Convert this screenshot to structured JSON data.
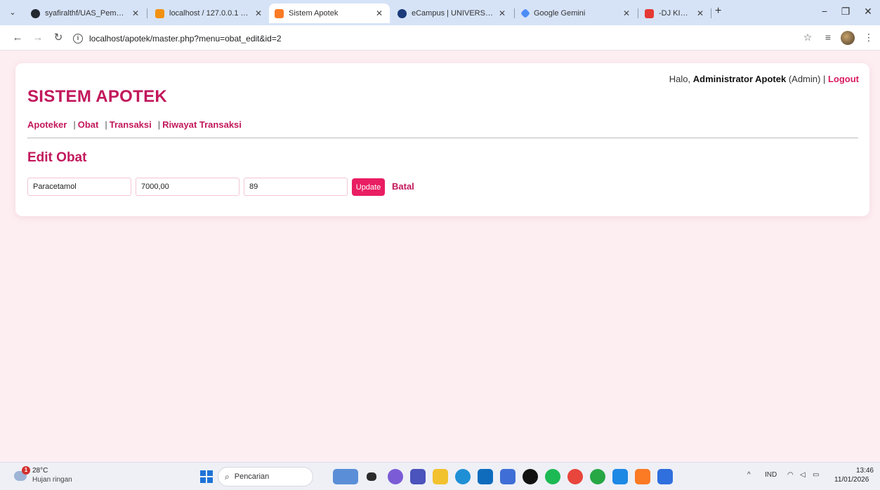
{
  "browser": {
    "tabs": [
      {
        "title": "syafiralthf/UAS_Pemrogram",
        "favicon_color": "#24292f"
      },
      {
        "title": "localhost / 127.0.0.1 / apo",
        "favicon_color": "#f29111"
      },
      {
        "title": "Sistem Apotek",
        "favicon_color": "#fb7a24"
      },
      {
        "title": "eCampus | UNIVERSITAS P",
        "favicon_color": "#1a3a7a"
      },
      {
        "title": "Google Gemini",
        "favicon_color": "#4c8df6"
      },
      {
        "title": "-DJ KISAH TANPA DIRI",
        "favicon_color": "#e53935"
      }
    ],
    "url": "localhost/apotek/master.php?menu=obat_edit&id=2"
  },
  "page": {
    "app_title": "SISTEM APOTEK",
    "greeting": "Halo,",
    "user_name": "Administrator Apotek",
    "user_role": "(Admin) |",
    "logout_label": "Logout",
    "nav": [
      "Apoteker",
      "Obat",
      "Transaksi",
      "Riwayat Transaksi"
    ],
    "section_title": "Edit Obat",
    "form": {
      "nama_obat": "Paracetamol",
      "harga": "7000,00",
      "stok": "89",
      "update_label": "Update",
      "batal_label": "Batal"
    }
  },
  "taskbar": {
    "weather_temp": "28°C",
    "weather_desc": "Hujan ringan",
    "weather_badge": "1",
    "search_placeholder": "Pencarian",
    "language": "IND",
    "time": "13:46",
    "date": "11/01/2026"
  },
  "colors": {
    "accent": "#c2185b",
    "button": "#e91e63",
    "page_background": "#fdeef2"
  }
}
